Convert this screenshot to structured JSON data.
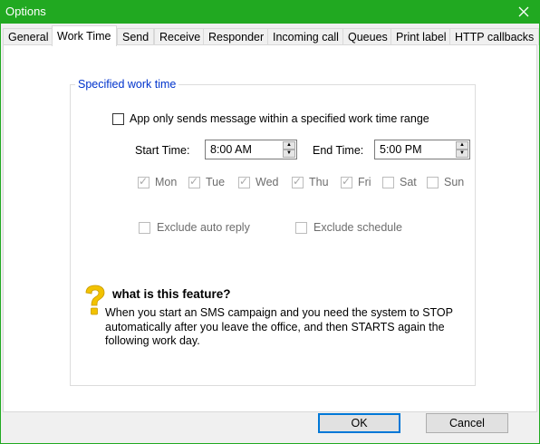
{
  "window": {
    "title": "Options"
  },
  "tabs": [
    {
      "label": "General"
    },
    {
      "label": "Work Time"
    },
    {
      "label": "Send"
    },
    {
      "label": "Receive"
    },
    {
      "label": "Responder"
    },
    {
      "label": "Incoming call"
    },
    {
      "label": "Queues"
    },
    {
      "label": "Print label"
    },
    {
      "label": "HTTP callbacks"
    }
  ],
  "worktime": {
    "group_label": "Specified work time",
    "enable_label": "App only sends message within a specified work time range",
    "enable_checked": false,
    "start_label": "Start Time:",
    "start_value": "8:00 AM",
    "end_label": "End Time:",
    "end_value": "5:00 PM",
    "days": [
      {
        "label": "Mon",
        "checked": true
      },
      {
        "label": "Tue",
        "checked": true
      },
      {
        "label": "Wed",
        "checked": true
      },
      {
        "label": "Thu",
        "checked": true
      },
      {
        "label": "Fri",
        "checked": true
      },
      {
        "label": "Sat",
        "checked": false
      },
      {
        "label": "Sun",
        "checked": false
      }
    ],
    "exclude_auto_reply_label": "Exclude auto reply",
    "exclude_schedule_label": "Exclude schedule"
  },
  "help": {
    "icon": "question-mark-icon",
    "title": "what is this feature?",
    "text": "When you start an SMS campaign and you need the system to STOP automatically after you leave the office, and then STARTS again the following work day."
  },
  "buttons": {
    "ok": "OK",
    "cancel": "Cancel"
  },
  "colors": {
    "titlebar": "#21a921",
    "legend": "#0033cc",
    "help_icon": "#f2c200"
  }
}
